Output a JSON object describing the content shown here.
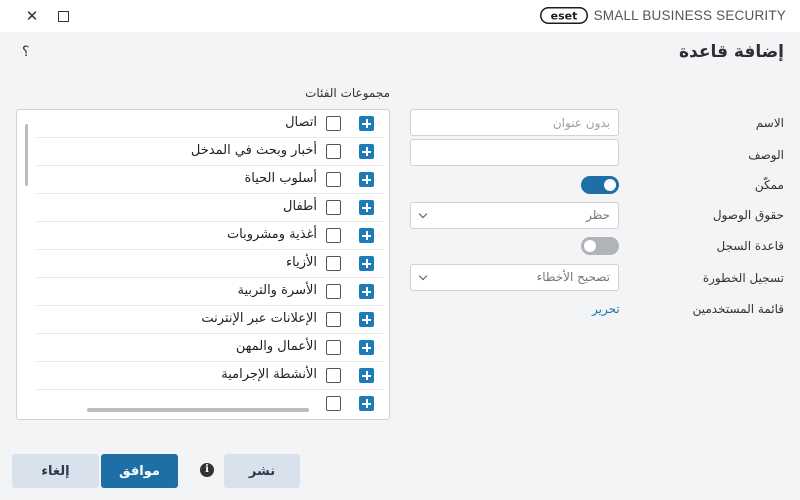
{
  "window": {
    "brand_logo": "eset",
    "brand_text": "SMALL BUSINESS SECURITY",
    "close_glyph": "✕"
  },
  "header": {
    "title": "إضافة قاعدة",
    "help_glyph": "؟"
  },
  "categories": {
    "label": "مجموعات الفئات",
    "items": [
      "اتصال",
      "أخبار وبحث في المدخل",
      "أسلوب الحياة",
      "أطفال",
      "أغذية ومشروبات",
      "الأزياء",
      "الأسرة والتربية",
      "الإعلانات عبر الإنترنت",
      "الأعمال والمهن",
      "الأنشطة الإجرامية"
    ]
  },
  "form": {
    "name_label": "الاسم",
    "name_placeholder": "بدون عنوان",
    "description_label": "الوصف",
    "enabled_label": "ممكّن",
    "enabled": true,
    "access_label": "حقوق الوصول",
    "access_value": "حظر",
    "log_rule_label": "قاعدة السجل",
    "log_rule": false,
    "severity_label": "تسجيل الخطورة",
    "severity_value": "تصحيح الأخطاء",
    "users_label": "قائمة المستخدمين",
    "users_edit": "تحرير"
  },
  "footer": {
    "cancel_label": "إلغاء",
    "ok_label": "موافق",
    "info_glyph": "i",
    "publish_label": "نشر"
  },
  "colors": {
    "accent": "#1d6fa5",
    "plus": "#1d7cb5",
    "secondary_button": "#d9e2ec"
  }
}
